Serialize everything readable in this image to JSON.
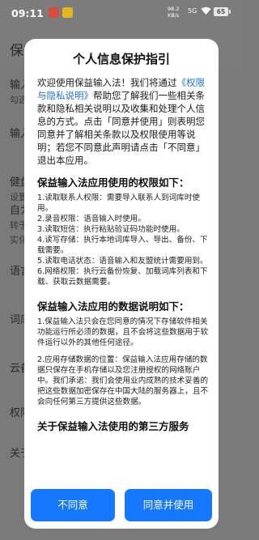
{
  "status_bar": {
    "time": "09:11",
    "net_speed_value": "98.2",
    "net_speed_unit": "KB/s",
    "signal": "5G",
    "battery": "65"
  },
  "background_page": {
    "title": "保益",
    "items": [
      {
        "label": "输入",
        "sub": "勾选"
      },
      {
        "label": "输入",
        "sub": ""
      },
      {
        "label": "健盘",
        "sub": "设置"
      },
      {
        "label": "自为",
        "sub": "转于"
      },
      {
        "label": "",
        "sub": "实化"
      },
      {
        "label": "语言",
        "sub": ""
      },
      {
        "label": "词库",
        "sub": ""
      },
      {
        "label": "云备",
        "sub": ""
      },
      {
        "label": "权限",
        "sub": ""
      },
      {
        "label": "关于",
        "sub": ""
      }
    ]
  },
  "dialog": {
    "title": "个人信息保护指引",
    "intro_prefix": "欢迎使用保益输入法！我们将通过",
    "intro_link": "《权限与隐私说明》",
    "intro_suffix": "帮助您了解我们一些相关条款和隐私相关说明以及收集和处理个人信息的方式。点击「同意并使用」则表明您同意并了解相关条款以及权限使用等说明；若您不同意此声明请点击「不同意」退出本应用。",
    "section1_title": "保益输入法应用使用的权限如下：",
    "permissions": [
      "1.读取联系人权限：需要导入联系人到词库时使用。",
      "2.录音权限：语音输入时使用。",
      "3.读取短信：执行粘贴验证码功能时使用。",
      "4.读写存储：执行本地词库导入、导出、备份、下载需要。",
      "5.读取电话状态：语音输入和友盟统计需要用到。",
      "6.网络权限：执行云备份恢复、加载词库列表和下载、获取云数据需要。"
    ],
    "section2_title": "保益输入法应用的数据说明如下：",
    "data_items": [
      "1.保益输入法只会在您同意的情况下存储软件相关功能运行所必须的数据，且不会将这些数据用于软件运行以外的其他任何途径。",
      " 2.应用存储数据的位置：保益输入法应用存储的数据只保存在手机存储以及您注册授权的网络账户中。我们承诺：我们会使用业内成熟的技术妥善的把这些数据加密保存在中国大陆的服务器上，且不会向任何第三方提供这些数据。"
    ],
    "section3_title": "关于保益输入法使用的第三方服务",
    "reject_label": "不同意",
    "accept_label": "同意并使用"
  }
}
